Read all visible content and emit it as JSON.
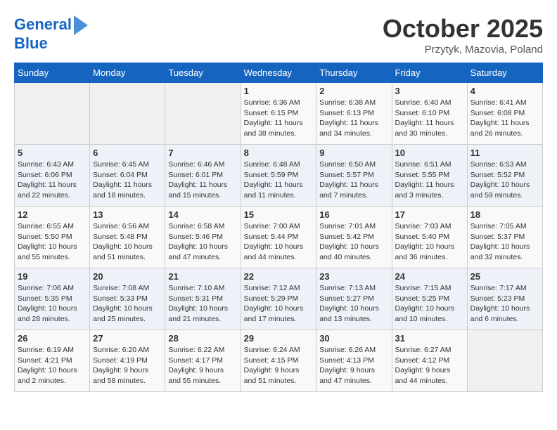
{
  "header": {
    "logo_line1": "General",
    "logo_line2": "Blue",
    "month": "October 2025",
    "location": "Przytyk, Mazovia, Poland"
  },
  "days_of_week": [
    "Sunday",
    "Monday",
    "Tuesday",
    "Wednesday",
    "Thursday",
    "Friday",
    "Saturday"
  ],
  "weeks": [
    [
      {
        "day": "",
        "info": ""
      },
      {
        "day": "",
        "info": ""
      },
      {
        "day": "",
        "info": ""
      },
      {
        "day": "1",
        "info": "Sunrise: 6:36 AM\nSunset: 6:15 PM\nDaylight: 11 hours\nand 38 minutes."
      },
      {
        "day": "2",
        "info": "Sunrise: 6:38 AM\nSunset: 6:13 PM\nDaylight: 11 hours\nand 34 minutes."
      },
      {
        "day": "3",
        "info": "Sunrise: 6:40 AM\nSunset: 6:10 PM\nDaylight: 11 hours\nand 30 minutes."
      },
      {
        "day": "4",
        "info": "Sunrise: 6:41 AM\nSunset: 6:08 PM\nDaylight: 11 hours\nand 26 minutes."
      }
    ],
    [
      {
        "day": "5",
        "info": "Sunrise: 6:43 AM\nSunset: 6:06 PM\nDaylight: 11 hours\nand 22 minutes."
      },
      {
        "day": "6",
        "info": "Sunrise: 6:45 AM\nSunset: 6:04 PM\nDaylight: 11 hours\nand 18 minutes."
      },
      {
        "day": "7",
        "info": "Sunrise: 6:46 AM\nSunset: 6:01 PM\nDaylight: 11 hours\nand 15 minutes."
      },
      {
        "day": "8",
        "info": "Sunrise: 6:48 AM\nSunset: 5:59 PM\nDaylight: 11 hours\nand 11 minutes."
      },
      {
        "day": "9",
        "info": "Sunrise: 6:50 AM\nSunset: 5:57 PM\nDaylight: 11 hours\nand 7 minutes."
      },
      {
        "day": "10",
        "info": "Sunrise: 6:51 AM\nSunset: 5:55 PM\nDaylight: 11 hours\nand 3 minutes."
      },
      {
        "day": "11",
        "info": "Sunrise: 6:53 AM\nSunset: 5:52 PM\nDaylight: 10 hours\nand 59 minutes."
      }
    ],
    [
      {
        "day": "12",
        "info": "Sunrise: 6:55 AM\nSunset: 5:50 PM\nDaylight: 10 hours\nand 55 minutes."
      },
      {
        "day": "13",
        "info": "Sunrise: 6:56 AM\nSunset: 5:48 PM\nDaylight: 10 hours\nand 51 minutes."
      },
      {
        "day": "14",
        "info": "Sunrise: 6:58 AM\nSunset: 5:46 PM\nDaylight: 10 hours\nand 47 minutes."
      },
      {
        "day": "15",
        "info": "Sunrise: 7:00 AM\nSunset: 5:44 PM\nDaylight: 10 hours\nand 44 minutes."
      },
      {
        "day": "16",
        "info": "Sunrise: 7:01 AM\nSunset: 5:42 PM\nDaylight: 10 hours\nand 40 minutes."
      },
      {
        "day": "17",
        "info": "Sunrise: 7:03 AM\nSunset: 5:40 PM\nDaylight: 10 hours\nand 36 minutes."
      },
      {
        "day": "18",
        "info": "Sunrise: 7:05 AM\nSunset: 5:37 PM\nDaylight: 10 hours\nand 32 minutes."
      }
    ],
    [
      {
        "day": "19",
        "info": "Sunrise: 7:06 AM\nSunset: 5:35 PM\nDaylight: 10 hours\nand 28 minutes."
      },
      {
        "day": "20",
        "info": "Sunrise: 7:08 AM\nSunset: 5:33 PM\nDaylight: 10 hours\nand 25 minutes."
      },
      {
        "day": "21",
        "info": "Sunrise: 7:10 AM\nSunset: 5:31 PM\nDaylight: 10 hours\nand 21 minutes."
      },
      {
        "day": "22",
        "info": "Sunrise: 7:12 AM\nSunset: 5:29 PM\nDaylight: 10 hours\nand 17 minutes."
      },
      {
        "day": "23",
        "info": "Sunrise: 7:13 AM\nSunset: 5:27 PM\nDaylight: 10 hours\nand 13 minutes."
      },
      {
        "day": "24",
        "info": "Sunrise: 7:15 AM\nSunset: 5:25 PM\nDaylight: 10 hours\nand 10 minutes."
      },
      {
        "day": "25",
        "info": "Sunrise: 7:17 AM\nSunset: 5:23 PM\nDaylight: 10 hours\nand 6 minutes."
      }
    ],
    [
      {
        "day": "26",
        "info": "Sunrise: 6:19 AM\nSunset: 4:21 PM\nDaylight: 10 hours\nand 2 minutes."
      },
      {
        "day": "27",
        "info": "Sunrise: 6:20 AM\nSunset: 4:19 PM\nDaylight: 9 hours\nand 58 minutes."
      },
      {
        "day": "28",
        "info": "Sunrise: 6:22 AM\nSunset: 4:17 PM\nDaylight: 9 hours\nand 55 minutes."
      },
      {
        "day": "29",
        "info": "Sunrise: 6:24 AM\nSunset: 4:15 PM\nDaylight: 9 hours\nand 51 minutes."
      },
      {
        "day": "30",
        "info": "Sunrise: 6:26 AM\nSunset: 4:13 PM\nDaylight: 9 hours\nand 47 minutes."
      },
      {
        "day": "31",
        "info": "Sunrise: 6:27 AM\nSunset: 4:12 PM\nDaylight: 9 hours\nand 44 minutes."
      },
      {
        "day": "",
        "info": ""
      }
    ]
  ]
}
